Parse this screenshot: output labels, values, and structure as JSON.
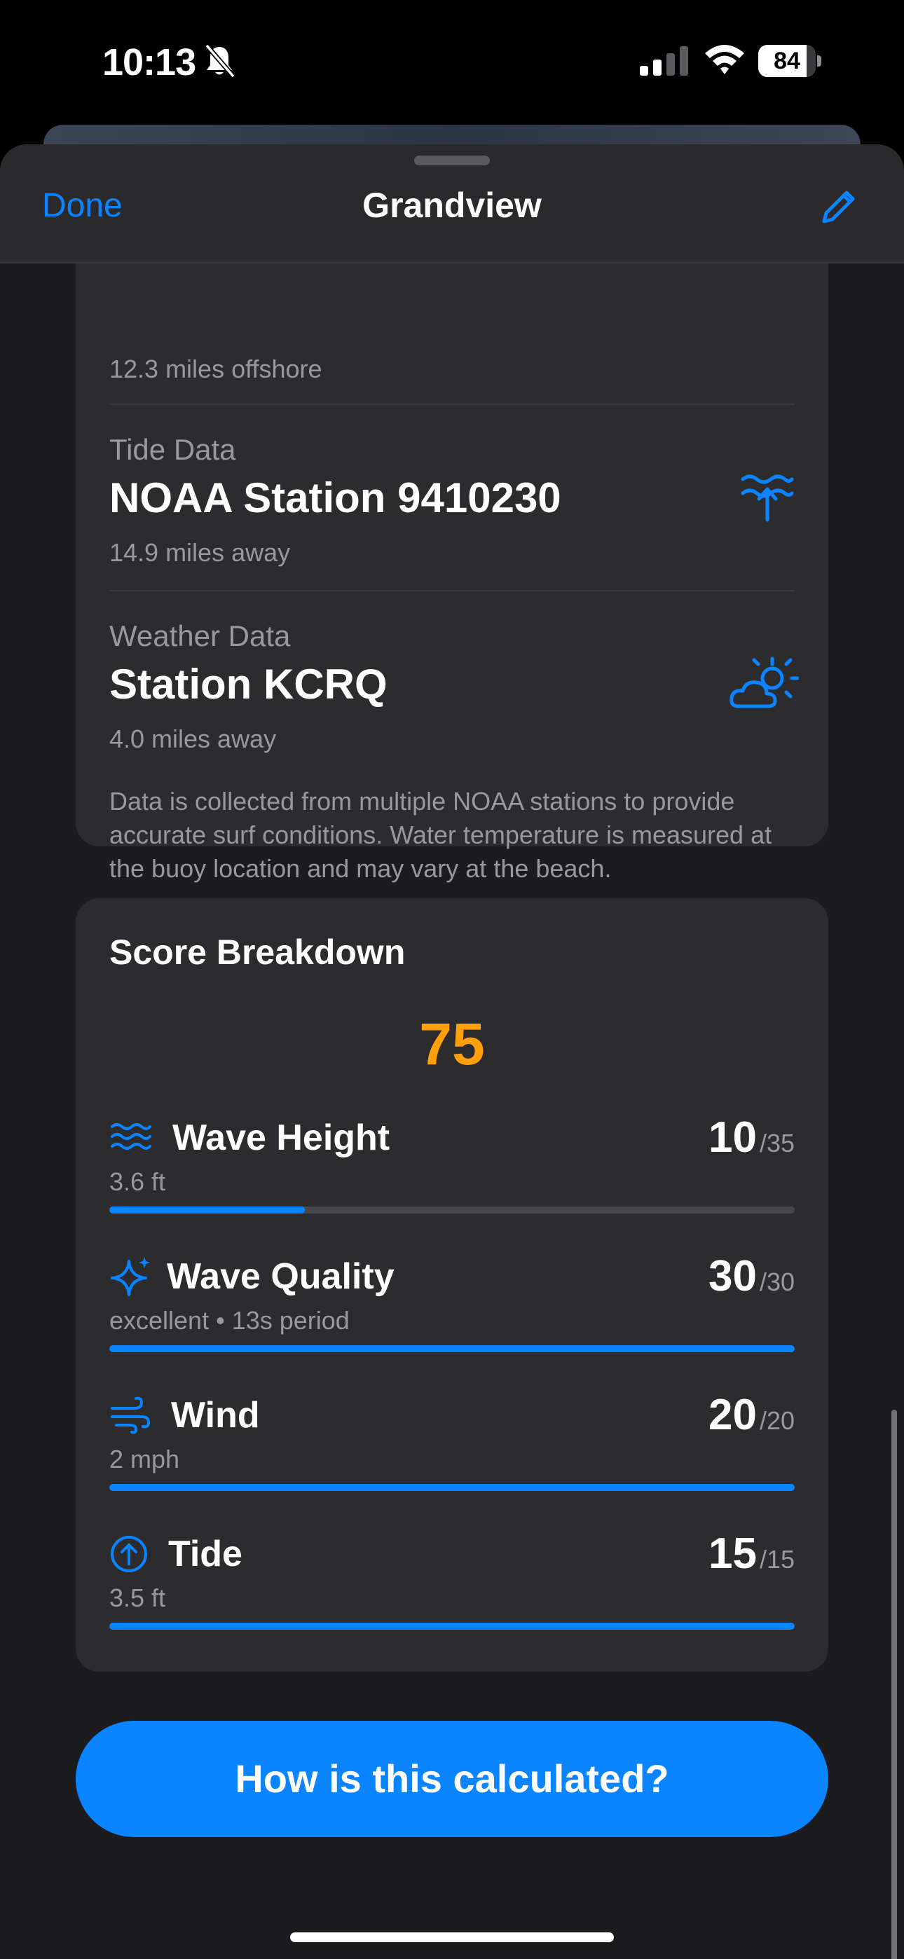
{
  "status_bar": {
    "time": "10:13",
    "battery_percent": 84,
    "battery_label": "84"
  },
  "nav": {
    "done_label": "Done",
    "title": "Grandview"
  },
  "sources": {
    "buoy_distance": "12.3 miles offshore",
    "tide": {
      "label": "Tide Data",
      "name": "NOAA Station 9410230",
      "distance": "14.9 miles away",
      "icon": "tide-water-icon"
    },
    "weather": {
      "label": "Weather Data",
      "name": "Station KCRQ",
      "distance": "4.0 miles away",
      "icon": "cloud-sun-icon"
    },
    "note": "Data is collected from multiple NOAA stations to provide accurate surf conditions. Water temperature is measured at the buoy location and may vary at the beach."
  },
  "score": {
    "title": "Score Breakdown",
    "total": "75",
    "total_color": "#ff9f0a",
    "factors": [
      {
        "name": "Wave Height",
        "detail": "3.6 ft",
        "points": "10",
        "max": "/35",
        "fraction": 0.2857,
        "icon": "waves-icon"
      },
      {
        "name": "Wave Quality",
        "detail": "excellent • 13s period",
        "points": "30",
        "max": "/30",
        "fraction": 1.0,
        "icon": "sparkle-icon"
      },
      {
        "name": "Wind",
        "detail": "2 mph",
        "points": "20",
        "max": "/20",
        "fraction": 1.0,
        "icon": "wind-icon"
      },
      {
        "name": "Tide",
        "detail": "3.5 ft",
        "points": "15",
        "max": "/15",
        "fraction": 1.0,
        "icon": "arrow-up-circle-icon"
      }
    ]
  },
  "cta_label": "How is this calculated?",
  "accent_color": "#0a84ff"
}
